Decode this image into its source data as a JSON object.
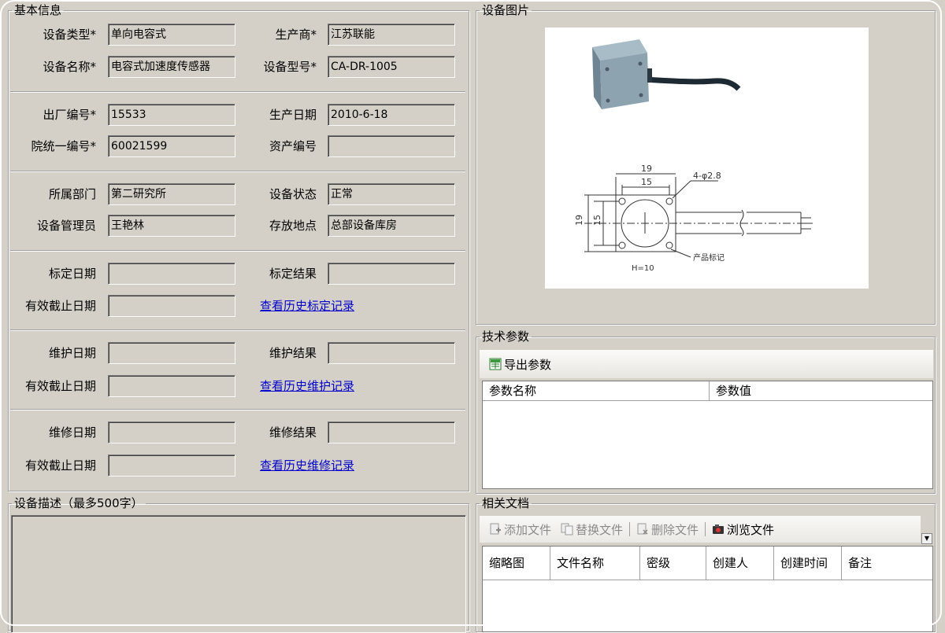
{
  "basic_info": {
    "title": "基本信息",
    "fields": [
      {
        "label": "设备类型*",
        "value": "单向电容式"
      },
      {
        "label": "生产商*",
        "value": "江苏联能"
      },
      {
        "label": "设备名称*",
        "value": "电容式加速度传感器"
      },
      {
        "label": "设备型号*",
        "value": "CA-DR-1005"
      },
      {
        "label": "出厂编号*",
        "value": "15533"
      },
      {
        "label": "生产日期",
        "value": "2010-6-18"
      },
      {
        "label": "院统一编号*",
        "value": "60021599"
      },
      {
        "label": "资产编号",
        "value": ""
      },
      {
        "label": "所属部门",
        "value": "第二研究所"
      },
      {
        "label": "设备状态",
        "value": "正常"
      },
      {
        "label": "设备管理员",
        "value": "王艳林"
      },
      {
        "label": "存放地点",
        "value": "总部设备库房"
      },
      {
        "label": "标定日期",
        "value": ""
      },
      {
        "label": "标定结果",
        "value": ""
      },
      {
        "label": "有效截止日期",
        "value": ""
      },
      {
        "label": "维护日期",
        "value": ""
      },
      {
        "label": "维护结果",
        "value": ""
      },
      {
        "label": "有效截止日期",
        "value": ""
      },
      {
        "label": "维修日期",
        "value": ""
      },
      {
        "label": "维修结果",
        "value": ""
      },
      {
        "label": "有效截止日期",
        "value": ""
      }
    ],
    "links": {
      "calibration_history": "查看历史标定记录",
      "maintenance_history": "查看历史维护记录",
      "repair_history": "查看历史维修记录"
    }
  },
  "description": {
    "title": "设备描述（最多500字）",
    "value": ""
  },
  "photo": {
    "title": "设备图片",
    "drawing": {
      "dim_19_top": "19",
      "dim_15_top": "15",
      "hole_spec": "4-φ2.8",
      "dim_19_side": "19",
      "dim_15_side": "15",
      "product_mark": "产品标记",
      "height": "H=10"
    }
  },
  "tech_params": {
    "title": "技术参数",
    "export_label": "导出参数",
    "columns": [
      "参数名称",
      "参数值"
    ],
    "rows": []
  },
  "documents": {
    "title": "相关文档",
    "toolbar": {
      "add": "添加文件",
      "replace": "替换文件",
      "delete": "删除文件",
      "browse": "浏览文件"
    },
    "columns": [
      "缩略图",
      "文件名称",
      "密级",
      "创建人",
      "创建时间",
      "备注"
    ],
    "rows": []
  },
  "colors": {
    "window_bg": "#d4d0c8",
    "link": "#0000cc",
    "field_bg": "#d4d0c8"
  }
}
